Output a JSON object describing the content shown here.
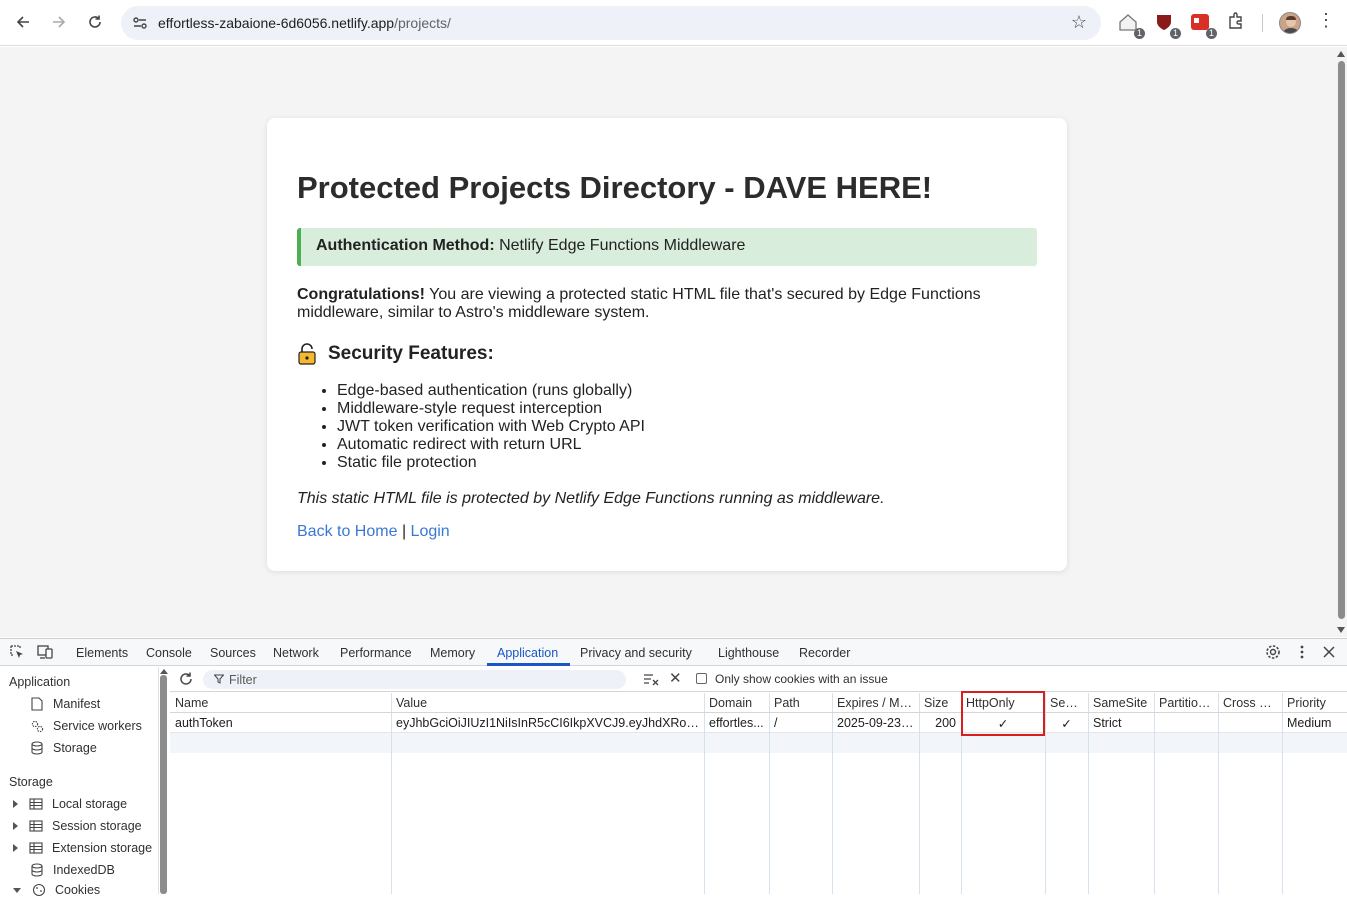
{
  "browser": {
    "url_host": "effortless-zabaione-6d6056.netlify.app",
    "url_path": "/projects/",
    "ext_badges": [
      "1",
      "1",
      "1"
    ]
  },
  "page": {
    "title": "Protected Projects Directory - DAVE HERE!",
    "auth_label": "Authentication Method:",
    "auth_value": "Netlify Edge Functions Middleware",
    "congrats_bold": "Congratulations!",
    "congrats_text": "You are viewing a protected static HTML file that's secured by Edge Functions middleware, similar to Astro's middleware system.",
    "security_heading": "Security Features:",
    "features": [
      "Edge-based authentication (runs globally)",
      "Middleware-style request interception",
      "JWT token verification with Web Crypto API",
      "Automatic redirect with return URL",
      "Static file protection"
    ],
    "note": "This static HTML file is protected by Netlify Edge Functions running as middleware.",
    "link_home": "Back to Home",
    "link_sep": "|",
    "link_login": "Login"
  },
  "devtools": {
    "tabs": [
      "Elements",
      "Console",
      "Sources",
      "Network",
      "Performance",
      "Memory",
      "Application",
      "Privacy and security",
      "Lighthouse",
      "Recorder"
    ],
    "active_tab": "Application",
    "sidebar": {
      "application_heading": "Application",
      "application_items": [
        "Manifest",
        "Service workers",
        "Storage"
      ],
      "storage_heading": "Storage",
      "storage_items": [
        "Local storage",
        "Session storage",
        "Extension storage",
        "IndexedDB",
        "Cookies"
      ]
    },
    "filter_placeholder": "Filter",
    "only_issues_label": "Only show cookies with an issue",
    "columns": [
      "Name",
      "Value",
      "Domain",
      "Path",
      "Expires / Ma...",
      "Size",
      "HttpOnly",
      "Secure",
      "SameSite",
      "Partition...",
      "Cross Site",
      "Priority"
    ],
    "cookie": {
      "name": "authToken",
      "value": "eyJhbGciOiJIUzI1NiIsInR5cCI6IkpXVCJ9.eyJhdXRoZW50...",
      "domain": "effortles...",
      "path": "/",
      "expires": "2025-09-23T...",
      "size": "200",
      "httponly": "✓",
      "secure": "✓",
      "samesite": "Strict",
      "partition": "",
      "cross_site": "",
      "priority": "Medium"
    }
  }
}
